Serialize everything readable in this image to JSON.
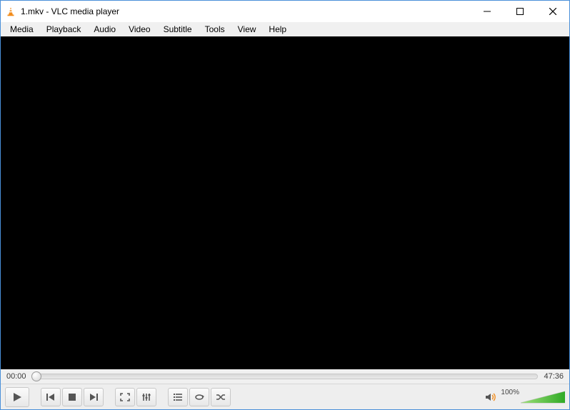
{
  "window": {
    "title": "1.mkv - VLC media player"
  },
  "menu": {
    "items": [
      "Media",
      "Playback",
      "Audio",
      "Video",
      "Subtitle",
      "Tools",
      "View",
      "Help"
    ]
  },
  "playback": {
    "elapsed": "00:00",
    "total": "47:36"
  },
  "volume": {
    "percent_label": "100%",
    "percent": 100
  }
}
